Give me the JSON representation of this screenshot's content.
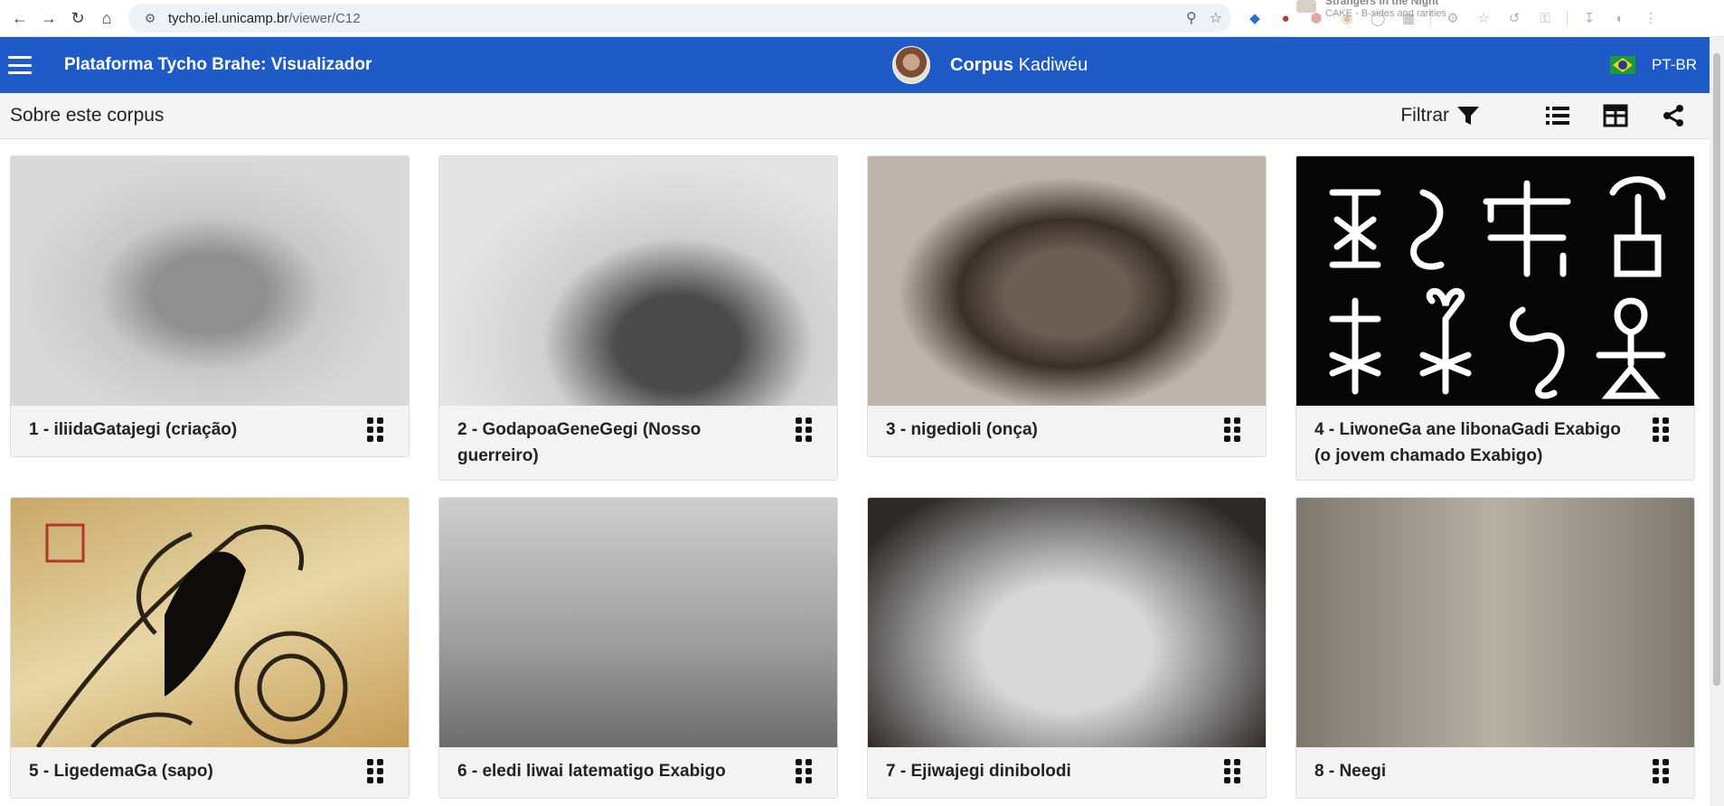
{
  "browser": {
    "url_host": "tycho.iel.unicamp.br",
    "url_path": "/viewer/C12",
    "media_title": "Strangers in the Night",
    "media_subtitle": "CAKE - B-sides and rarities"
  },
  "header": {
    "app_title": "Plataforma Tycho Brahe: Visualizador",
    "corpus_word": "Corpus",
    "corpus_name": "Kadiwéu",
    "language": "PT-BR"
  },
  "toolbar": {
    "about_label": "Sobre este corpus",
    "filter_label": "Filtrar"
  },
  "cards": [
    {
      "title": "1 - iliidaGatajegi (criação)"
    },
    {
      "title": "2 - GodapoaGeneGegi (Nosso guerreiro)"
    },
    {
      "title": "3 - nigedioli (onça)"
    },
    {
      "title": "4 - LiwoneGa ane libonaGadi Exabigo (o jovem chamado Exabigo)"
    },
    {
      "title": "5 - LigedemaGa (sapo)"
    },
    {
      "title": "6 - eledi liwai latematigo Exabigo"
    },
    {
      "title": "7 - Ejiwajegi dinibolodi"
    },
    {
      "title": "8 - Neegi"
    }
  ]
}
